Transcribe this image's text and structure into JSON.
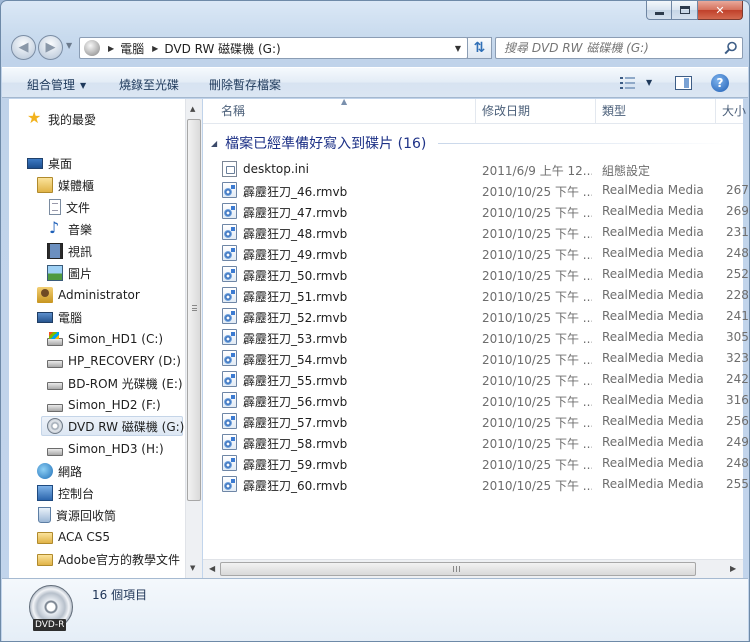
{
  "window": {
    "caption_icons": [
      "minimize-icon",
      "maximize-icon",
      "close-icon"
    ]
  },
  "address": {
    "crumbs": [
      "電腦",
      "DVD RW 磁碟機 (G:)"
    ]
  },
  "search": {
    "placeholder": "搜尋 DVD RW 磁碟機 (G:)"
  },
  "toolbar": {
    "organize": "組合管理",
    "burn": "燒錄至光碟",
    "delete_temp": "刪除暫存檔案"
  },
  "nav": {
    "favorites": "我的最愛",
    "desktop": "桌面",
    "libraries": "媒體櫃",
    "documents": "文件",
    "music": "音樂",
    "videos": "視訊",
    "pictures": "圖片",
    "user": "Administrator",
    "computer": "電腦",
    "drive_c": "Simon_HD1 (C:)",
    "drive_d": "HP_RECOVERY (D:)",
    "drive_e": "BD-ROM 光碟機 (E:)",
    "drive_f": "Simon_HD2 (F:)",
    "drive_g": "DVD RW 磁碟機 (G:)",
    "drive_h": "Simon_HD3 (H:)",
    "network": "網路",
    "control_panel": "控制台",
    "recycle_bin": "資源回收筒",
    "folder_aca": "ACA CS5",
    "folder_adobe": "Adobe官方的教學文件"
  },
  "columns": {
    "name": "名稱",
    "date": "修改日期",
    "type": "類型",
    "size": "大小"
  },
  "group_header": "檔案已經準備好寫入到碟片 (16)",
  "files": [
    {
      "name": "desktop.ini",
      "date": "2011/6/9 上午 12...",
      "type": "組態設定",
      "size": "",
      "icon": "ini"
    },
    {
      "name": "霹靂狂刀_46.rmvb",
      "date": "2010/10/25 下午 ...",
      "type": "RealMedia Media",
      "size": "267",
      "icon": "media"
    },
    {
      "name": "霹靂狂刀_47.rmvb",
      "date": "2010/10/25 下午 ...",
      "type": "RealMedia Media",
      "size": "269",
      "icon": "media"
    },
    {
      "name": "霹靂狂刀_48.rmvb",
      "date": "2010/10/25 下午 ...",
      "type": "RealMedia Media",
      "size": "231",
      "icon": "media"
    },
    {
      "name": "霹靂狂刀_49.rmvb",
      "date": "2010/10/25 下午 ...",
      "type": "RealMedia Media",
      "size": "248",
      "icon": "media"
    },
    {
      "name": "霹靂狂刀_50.rmvb",
      "date": "2010/10/25 下午 ...",
      "type": "RealMedia Media",
      "size": "252",
      "icon": "media"
    },
    {
      "name": "霹靂狂刀_51.rmvb",
      "date": "2010/10/25 下午 ...",
      "type": "RealMedia Media",
      "size": "228",
      "icon": "media"
    },
    {
      "name": "霹靂狂刀_52.rmvb",
      "date": "2010/10/25 下午 ...",
      "type": "RealMedia Media",
      "size": "241",
      "icon": "media"
    },
    {
      "name": "霹靂狂刀_53.rmvb",
      "date": "2010/10/25 下午 ...",
      "type": "RealMedia Media",
      "size": "305",
      "icon": "media"
    },
    {
      "name": "霹靂狂刀_54.rmvb",
      "date": "2010/10/25 下午 ...",
      "type": "RealMedia Media",
      "size": "323",
      "icon": "media"
    },
    {
      "name": "霹靂狂刀_55.rmvb",
      "date": "2010/10/25 下午 ...",
      "type": "RealMedia Media",
      "size": "242",
      "icon": "media"
    },
    {
      "name": "霹靂狂刀_56.rmvb",
      "date": "2010/10/25 下午 ...",
      "type": "RealMedia Media",
      "size": "316",
      "icon": "media"
    },
    {
      "name": "霹靂狂刀_57.rmvb",
      "date": "2010/10/25 下午 ...",
      "type": "RealMedia Media",
      "size": "256",
      "icon": "media"
    },
    {
      "name": "霹靂狂刀_58.rmvb",
      "date": "2010/10/25 下午 ...",
      "type": "RealMedia Media",
      "size": "249",
      "icon": "media"
    },
    {
      "name": "霹靂狂刀_59.rmvb",
      "date": "2010/10/25 下午 ...",
      "type": "RealMedia Media",
      "size": "248",
      "icon": "media"
    },
    {
      "name": "霹靂狂刀_60.rmvb",
      "date": "2010/10/25 下午 ...",
      "type": "RealMedia Media",
      "size": "255",
      "icon": "media"
    }
  ],
  "details": {
    "item_count": "16 個項目",
    "drive_icon_label": "DVD-R"
  },
  "colors": {
    "group_header": "#1e3287",
    "selection": "#dde7f3",
    "toolbar_text": "#1e395b"
  }
}
